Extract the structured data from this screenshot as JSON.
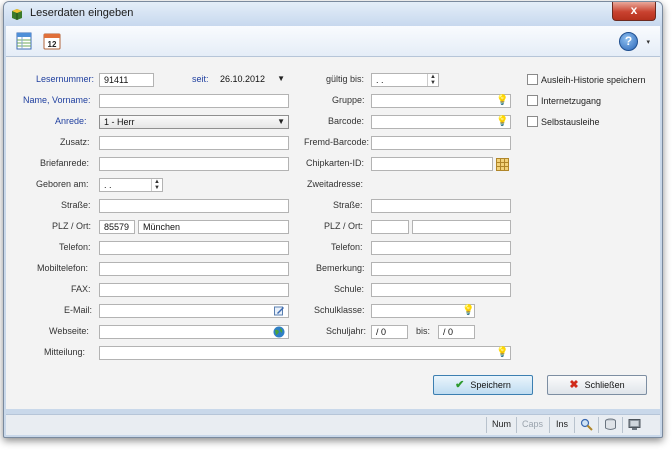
{
  "window": {
    "title": "Leserdaten eingeben",
    "close_label": "x"
  },
  "toolbar": {
    "help_label": "?",
    "help_dropdown": "▾",
    "calendar_day": "12"
  },
  "form": {
    "lesernummer_label": "Lesernummer:",
    "lesernummer_value": "91411",
    "seit_label": "seit:",
    "seit_value": "26.10.2012",
    "gueltig_label": "gültig bis:",
    "gueltig_value": ". .",
    "name_label": "Name, Vorname:",
    "name_value": "",
    "anrede_label": "Anrede:",
    "anrede_value": "1 - Herr",
    "zusatz_label": "Zusatz:",
    "briefanrede_label": "Briefanrede:",
    "geboren_label": "Geboren am:",
    "geboren_value": ". .",
    "strasse_label": "Straße:",
    "plz_label": "PLZ / Ort:",
    "plz_value": "85579",
    "ort_value": "München",
    "telefon_label": "Telefon:",
    "mobil_label": "Mobiltelefon:",
    "fax_label": "FAX:",
    "email_label": "E-Mail:",
    "webseite_label": "Webseite:",
    "mitteilung_label": "Mitteilung:",
    "gruppe_label": "Gruppe:",
    "barcode_label": "Barcode:",
    "fremd_barcode_label": "Fremd-Barcode:",
    "chipkarten_label": "Chipkarten-ID:",
    "zweitadresse_label": "Zweitadresse:",
    "strasse2_label": "Straße:",
    "plz2_label": "PLZ / Ort:",
    "telefon2_label": "Telefon:",
    "bemerkung_label": "Bemerkung:",
    "schule_label": "Schule:",
    "schulklasse_label": "Schulklasse:",
    "schuljahr_label": "Schuljahr:",
    "schuljahr_from": "/ 0",
    "bis_label": "bis:",
    "schuljahr_to": "/ 0"
  },
  "options": {
    "ausleih_historie": "Ausleih-Historie speichern",
    "internetzugang": "Internetzugang",
    "selbstausleihe": "Selbstausleihe"
  },
  "buttons": {
    "save": "Speichern",
    "close": "Schließen"
  },
  "status": {
    "num": "Num",
    "caps": "Caps",
    "ins": "Ins"
  },
  "colors": {
    "label_blue": "#1f3f9f",
    "close_red": "#c9422f",
    "window_frame": "#c9d8ea"
  }
}
